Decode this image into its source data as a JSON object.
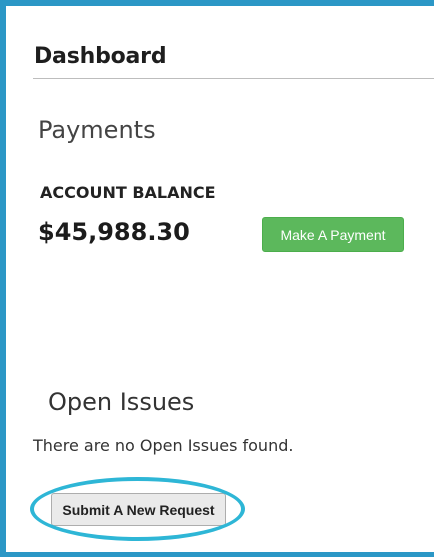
{
  "dashboard": {
    "title": "Dashboard"
  },
  "payments": {
    "heading": "Payments",
    "balance_label": "ACCOUNT BALANCE",
    "balance_amount": "$45,988.30",
    "pay_button_label": "Make A Payment",
    "pay_button_color": "#5cb85c"
  },
  "issues": {
    "heading": "Open Issues",
    "empty_message": "There are no Open Issues found.",
    "submit_button_label": "Submit A New Request"
  },
  "colors": {
    "frame_border": "#2b97c6",
    "highlight_ring": "#2eb6d6"
  }
}
